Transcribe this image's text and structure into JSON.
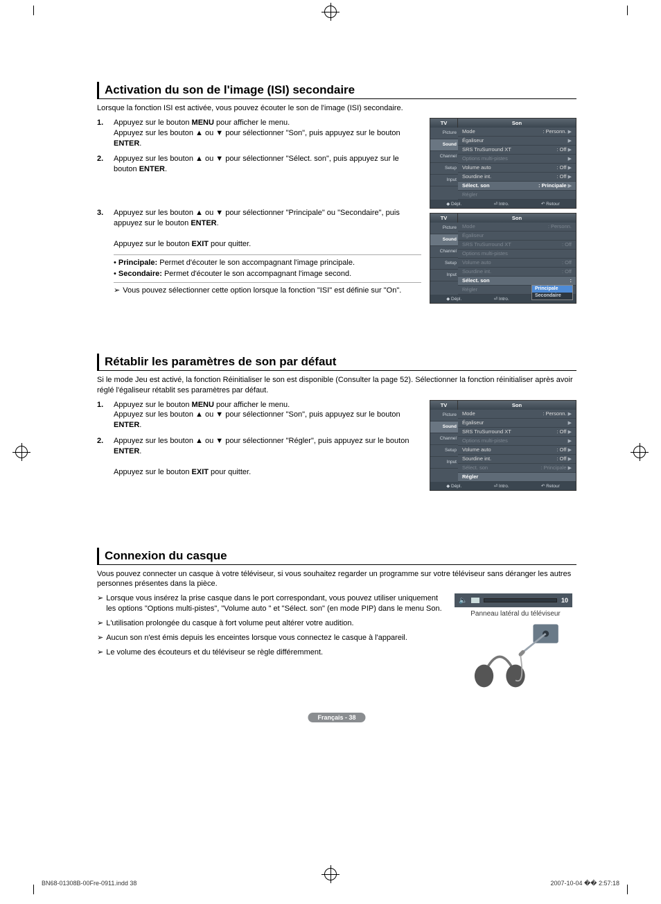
{
  "section1": {
    "title": "Activation du son de l'image (ISI) secondaire",
    "intro": "Lorsque la fonction ISI est activée, vous pouvez écouter le son de l'image (ISI) secondaire.",
    "step1_pre": "Appuyez sur le bouton ",
    "step1_b": "MENU",
    "step1_mid": " pour afficher le menu.\nAppuyez sur les bouton ▲ ou ▼ pour sélectionner \"Son\", puis appuyez sur le bouton ",
    "step1_b2": "ENTER",
    "step1_end": ".",
    "step2_pre": "Appuyez sur les bouton ▲ ou ▼ pour sélectionner \"Sélect. son\", puis appuyez sur le bouton ",
    "step2_b": "ENTER",
    "step2_end": ".",
    "step3_pre": "Appuyez sur les bouton ▲ ou ▼ pour sélectionner \"Principale\" ou \"Secondaire\", puis appuyez sur le bouton ",
    "step3_b": "ENTER",
    "step3_end": ".",
    "exit_pre": "Appuyez sur le bouton ",
    "exit_b": "EXIT",
    "exit_end": " pour quitter.",
    "bullet1_b": "Principale:",
    "bullet1": " Permet d'écouter le son accompagnant l'image principale.",
    "bullet2_b": "Secondaire:",
    "bullet2": " Permet d'écouter le son accompagnant l'image second.",
    "note1": "Vous pouvez sélectionner cette option lorsque la fonction \"ISI\" est définie sur \"On\"."
  },
  "section2": {
    "title": "Rétablir les paramètres de son par défaut",
    "intro": "Si le mode Jeu est activé, la fonction Réinitialiser le son est disponible (Consulter la page 52). Sélectionner la fonction réinitialiser après avoir réglé l'égaliseur rétablit ses paramètres par défaut.",
    "step1_pre": "Appuyez sur le bouton ",
    "step1_b": "MENU",
    "step1_mid": " pour afficher le menu.\nAppuyez sur les bouton ▲ ou ▼ pour sélectionner \"Son\", puis appuyez sur le bouton ",
    "step1_b2": "ENTER",
    "step1_end": ".",
    "step2_pre": "Appuyez sur les bouton ▲ ou ▼ pour sélectionner \"Régler\", puis appuyez sur le bouton ",
    "step2_b": "ENTER",
    "step2_end": ".",
    "exit_pre": "Appuyez sur le bouton ",
    "exit_b": "EXIT",
    "exit_end": " pour quitter."
  },
  "section3": {
    "title": "Connexion du casque",
    "intro": "Vous pouvez connecter un casque à votre téléviseur, si vous souhaitez regarder un programme sur votre téléviseur sans déranger les autres personnes présentes dans la pièce.",
    "note1": "Lorsque vous insérez la prise casque dans le port correspondant, vous pouvez utiliser uniquement les options \"Options multi-pistes\", \"Volume auto \" et \"Sélect. son\" (en mode PIP) dans le menu Son.",
    "note2": "L'utilisation prolongée du casque à fort volume peut altérer votre audition.",
    "note3": "Aucun son n'est émis depuis les enceintes lorsque vous connectez le casque à l'appareil.",
    "note4": "Le volume des écouteurs et du téléviseur se règle différemment.",
    "fig_caption": "Panneau latéral du téléviseur",
    "vol_value": "10"
  },
  "osd": {
    "tv": "TV",
    "title": "Son",
    "tabs": [
      "Picture",
      "Sound",
      "Channel",
      "Setup",
      "Input"
    ],
    "rows": {
      "mode_l": "Mode",
      "mode_v": ": Personn.",
      "eq": "Égaliseur",
      "srs_l": "SRS TruSurround XT",
      "srs_v": ": Off",
      "multi": "Options multi-pistes",
      "vol_l": "Volume auto",
      "vol_v": ": Off",
      "mute_l": "Sourdine int.",
      "mute_v": ": Off",
      "sel_l": "Sélect. son",
      "sel_v": ": Principale",
      "reset": "Régler"
    },
    "dd": {
      "opt1": "Principale",
      "opt2": "Secondaire"
    },
    "ftr": {
      "move": "Dépl.",
      "enter": "Intro.",
      "ret": "Retour"
    }
  },
  "page_badge": "Français - 38",
  "footer_left": "BN68-01308B-00Fre-0911.indd   38",
  "footer_right": "2007-10-04   �� 2:57:18"
}
